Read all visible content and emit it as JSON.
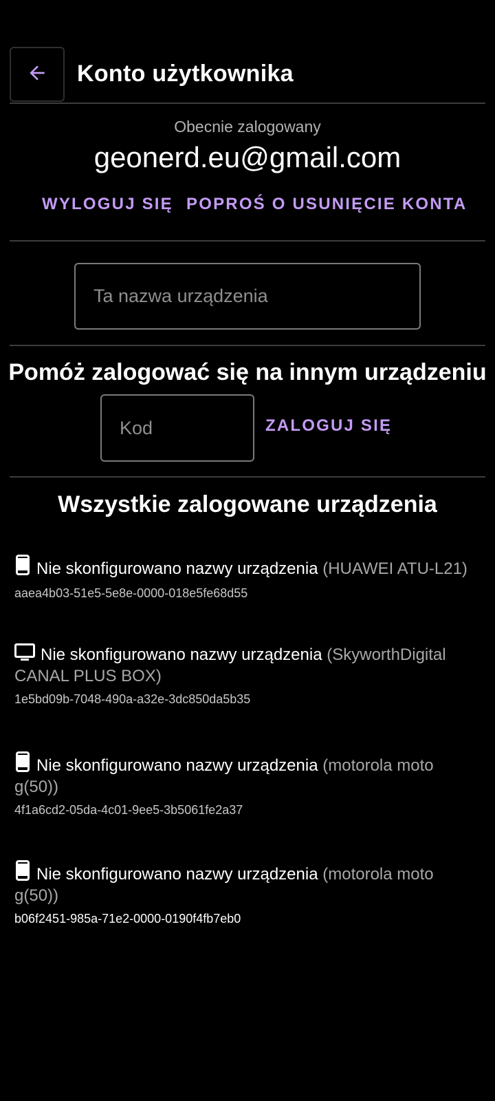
{
  "header": {
    "back_icon": "arrow-back-icon",
    "title": "Konto użytkownika"
  },
  "account": {
    "logged_in_label": "Obecnie zalogowany",
    "email": "geonerd.eu@gmail.com",
    "logout_label": "WYLOGUJ SIĘ",
    "delete_account_label": "POPROŚ O USUNIĘCIE KONTA"
  },
  "device_name_field": {
    "placeholder": "Ta nazwa urządzenia",
    "value": ""
  },
  "help_login": {
    "title": "Pomóż zalogować się na innym urządzeniu",
    "code_placeholder": "Kod",
    "code_value": "",
    "login_label": "ZALOGUJ SIĘ"
  },
  "devices": {
    "title": "Wszystkie zalogowane urządzenia",
    "items": [
      {
        "icon": "phone-icon",
        "name": "Nie skonfigurowano nazwy urządzenia",
        "model": "(HUAWEI ATU-L21)",
        "id": "aaea4b03-51e5-5e8e-0000-018e5fe68d55"
      },
      {
        "icon": "tv-icon",
        "name": "Nie skonfigurowano nazwy urządzenia",
        "model": "(SkyworthDigital CANAL PLUS BOX)",
        "id": "1e5bd09b-7048-490a-a32e-3dc850da5b35"
      },
      {
        "icon": "phone-icon",
        "name": "Nie skonfigurowano nazwy urządzenia",
        "model": "(motorola moto g(50))",
        "id": "4f1a6cd2-05da-4c01-9ee5-3b5061fe2a37"
      },
      {
        "icon": "phone-icon",
        "name": "Nie skonfigurowano nazwy urządzenia",
        "model": "(motorola moto g(50))",
        "id": "b06f2451-985a-71e2-0000-0190f4fb7eb0"
      }
    ]
  },
  "colors": {
    "background": "#000000",
    "accent": "#c39bf5",
    "divider": "#3c3c3c",
    "secondary_text": "#b3b3b3"
  }
}
